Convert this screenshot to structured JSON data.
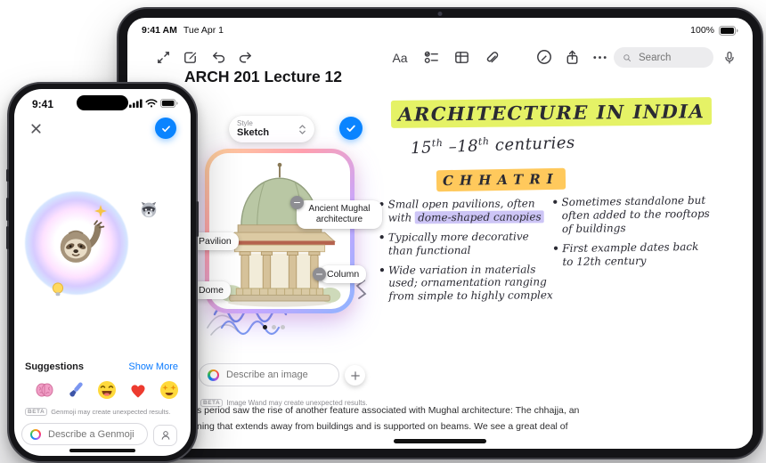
{
  "colors": {
    "accent": "#0a84ff",
    "highlight_yellow": "#e5f266",
    "highlight_orange": "#ffc95c",
    "highlight_purple": "#cdc5f6"
  },
  "ipad": {
    "status": {
      "time": "9:41 AM",
      "date": "Tue Apr 1",
      "battery_percent": "100%"
    },
    "toolbar": {
      "format_label": "Aa",
      "search_placeholder": "Search"
    },
    "note": {
      "title": "ARCH 201 Lecture 12",
      "heading": "ARCHITECTURE IN INDIA",
      "sub_p1": "15",
      "sub_sup1": "th",
      "sub_p2": " –18",
      "sub_sup2": "th",
      "sub_p3": " centuries",
      "section_title": "CHHATRI",
      "bullet1_pre": "Small open pavilions, often with ",
      "bullet1_highlight": "dome-shaped canopies",
      "bullet2": "Typically more decorative than functional",
      "bullet3": "Wide variation in materials used; ornamentation ranging from simple to highly complex",
      "bullet4": "Sometimes standalone but often added to the rooftops of buildings",
      "bullet5": "First example dates back to 12th century",
      "body_line1": "s period saw the rise of another feature associated with Mughal architecture: The chhajja, an",
      "body_line2": "ning that extends away from buildings and is supported on beams. We see a great deal of"
    },
    "image_wand": {
      "style_label": "Style",
      "style_value": "Sketch",
      "tag_subject": "Ancient Mughal architecture",
      "tag_pavilion": "Pavilion",
      "tag_dome": "Dome",
      "tag_column": "Column",
      "input_placeholder": "Describe an image",
      "beta_badge": "BETA",
      "beta_note": "Image Wand may create unexpected results."
    }
  },
  "iphone": {
    "status": {
      "time": "9:41"
    },
    "genmoji": {
      "suggestions_label": "Suggestions",
      "show_more_label": "Show More",
      "emoji_suggestions": [
        "brain",
        "paintbrush",
        "laughing-face",
        "red-heart",
        "star-struck"
      ],
      "main_emoji": "sloth-waving-with-sparkle",
      "thumbnail_top": "raccoon",
      "thumbnail_bottom": "lightbulb",
      "beta_badge": "BETA",
      "beta_note": "Genmoji may create unexpected results.",
      "input_placeholder": "Describe a Genmoji"
    }
  }
}
